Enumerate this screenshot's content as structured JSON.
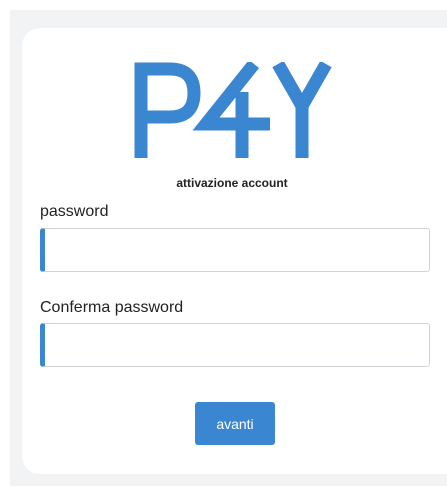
{
  "brand": {
    "logo_text": "P4Y",
    "color": "#3b86d0"
  },
  "form": {
    "subtitle": "attivazione account",
    "password_label": "password",
    "password_value": "",
    "confirm_label": "Conferma password",
    "confirm_value": "",
    "submit_label": "avanti"
  },
  "colors": {
    "accent": "#3b86d0",
    "page_background": "#f2f3f5",
    "card_background": "#ffffff"
  }
}
